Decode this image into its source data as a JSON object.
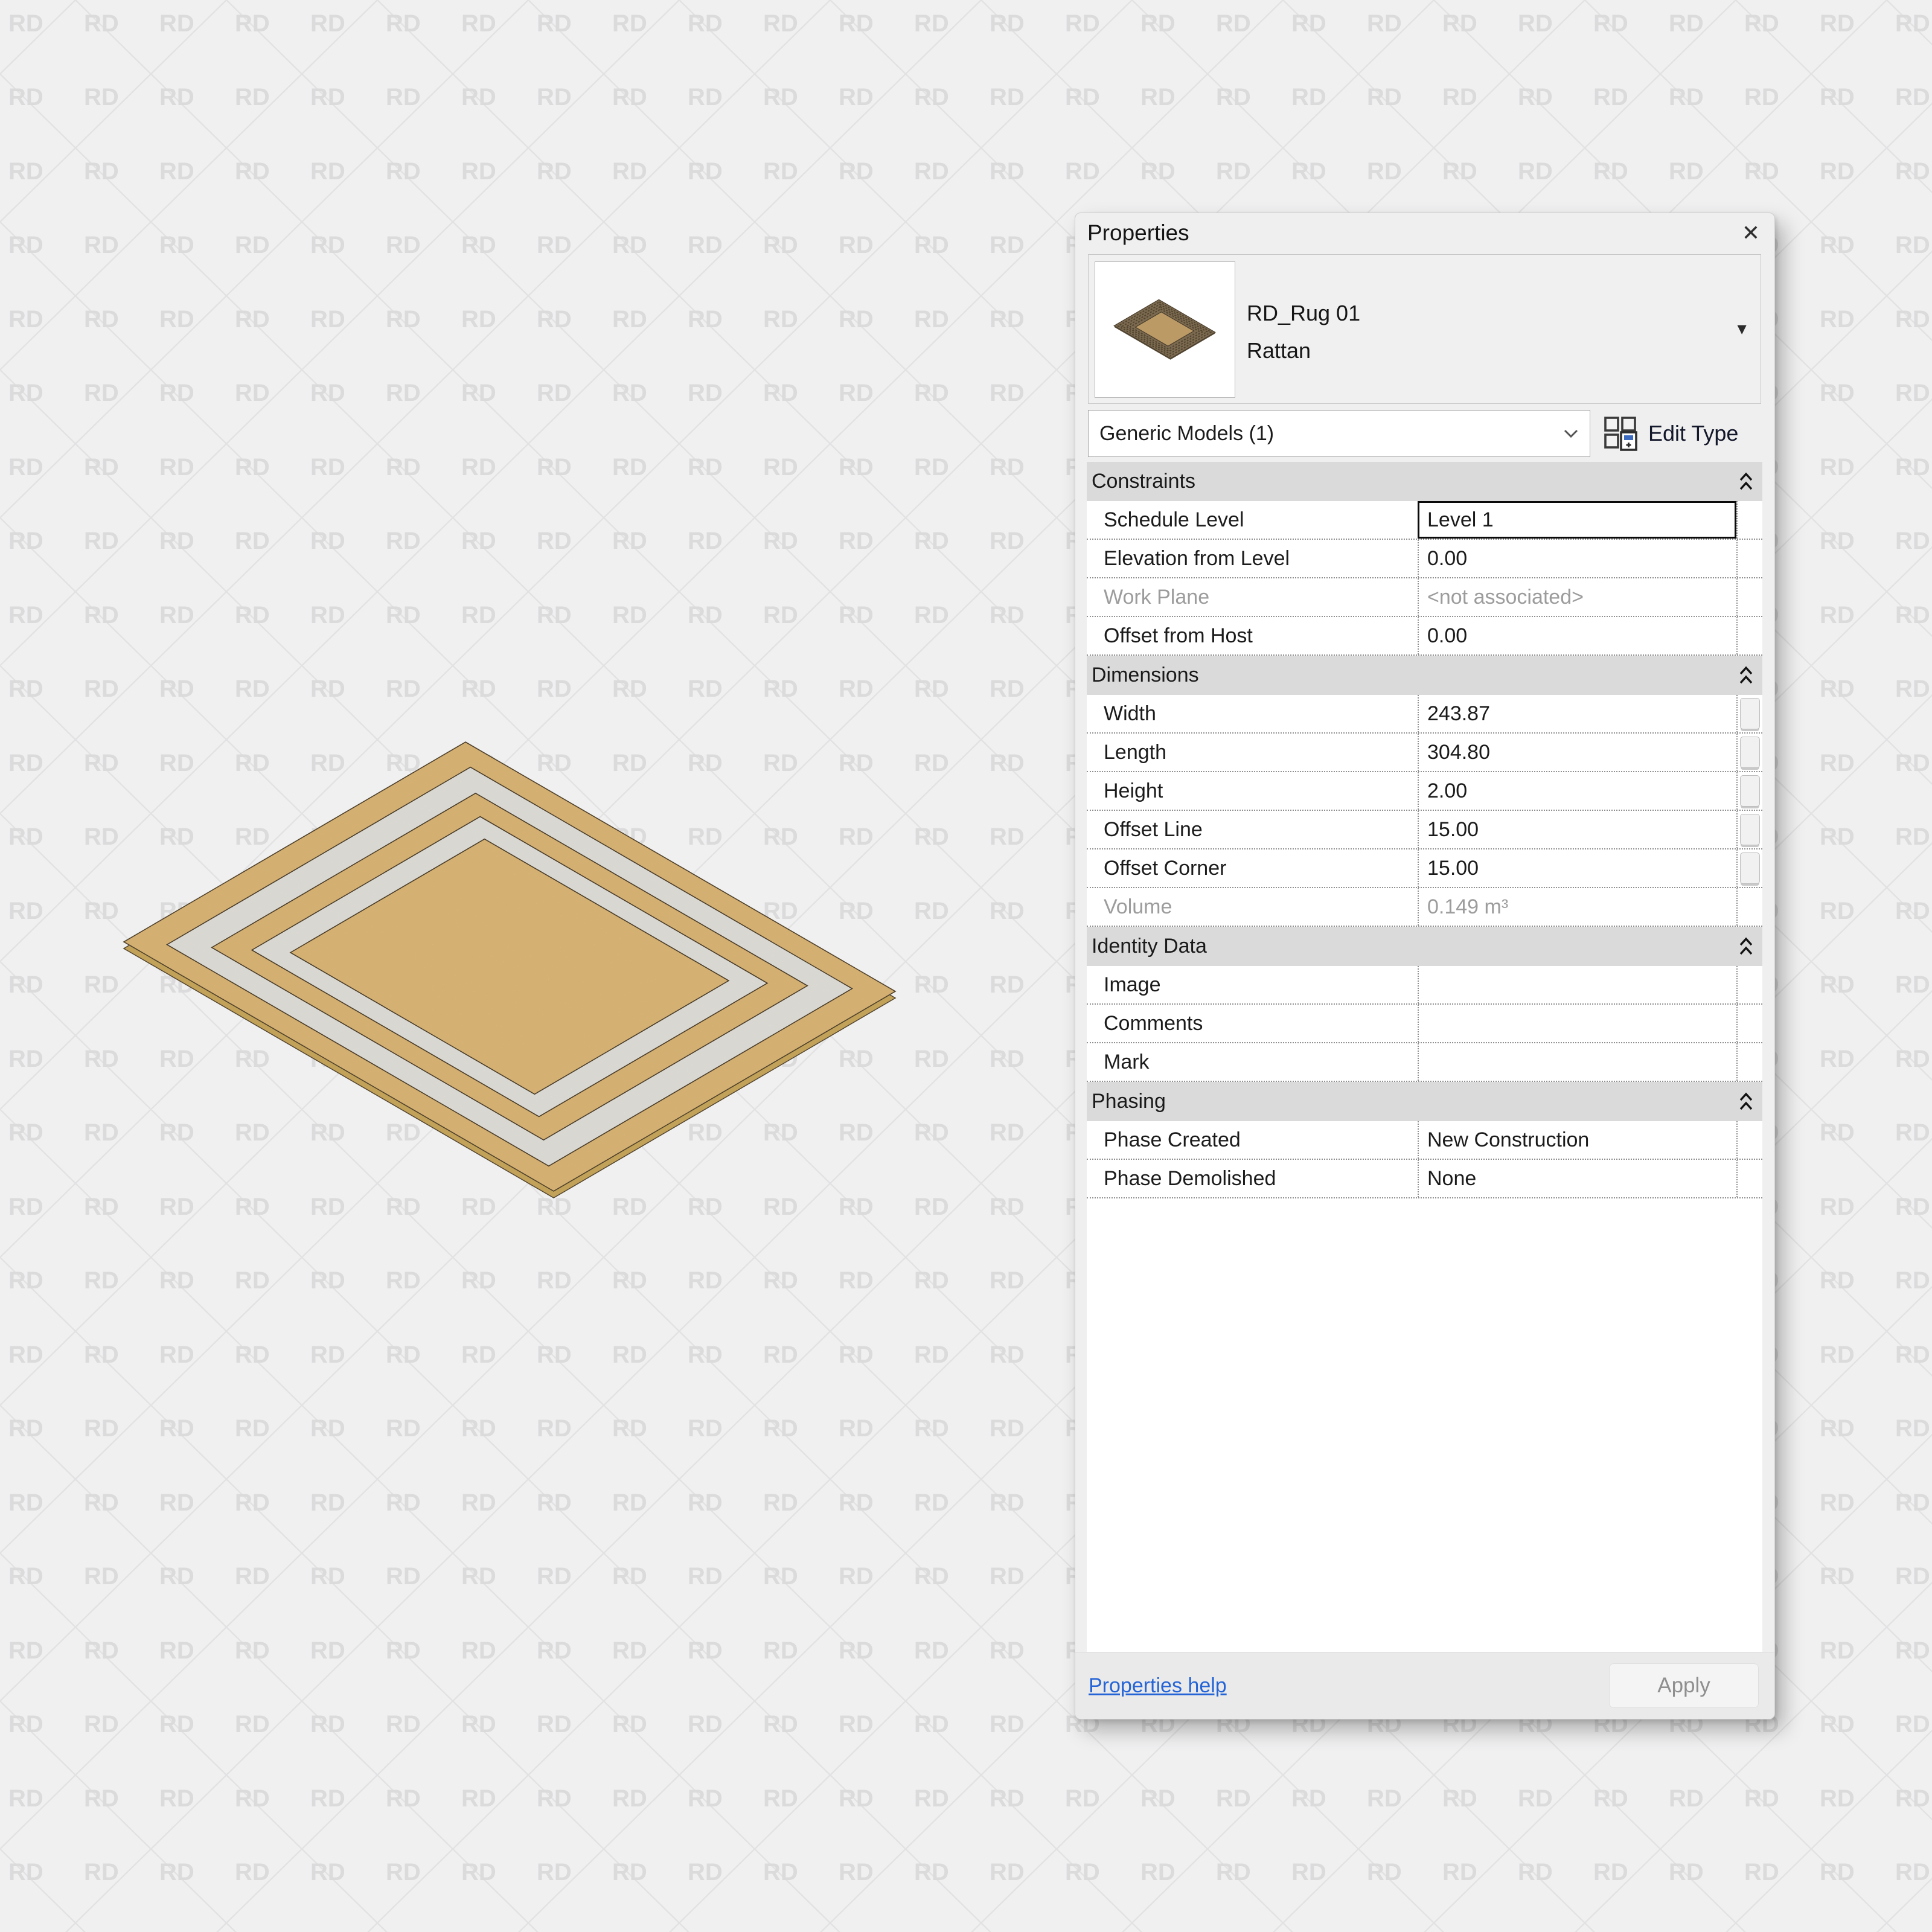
{
  "background": {
    "watermark_text": "RD"
  },
  "rug_colors": {
    "tan": "#ecc47f",
    "tan_center": "#edc680",
    "white_band": "#f2f1eb",
    "outline": "#54452f",
    "side": "#c2a258"
  },
  "panel": {
    "title": "Properties",
    "close_icon": "✕",
    "preview": {
      "family_name": "RD_Rug 01",
      "type_name": "Rattan",
      "dropdown_icon": "▼"
    },
    "type_selector": {
      "value": "Generic Models (1)"
    },
    "edit_type_label": "Edit Type",
    "sections": [
      {
        "title": "Constraints",
        "rows": [
          {
            "label": "Schedule Level",
            "value": "Level 1",
            "focused": true
          },
          {
            "label": "Elevation from Level",
            "value": "0.00"
          },
          {
            "label": "Work Plane",
            "value": "<not associated>",
            "disabled": true
          },
          {
            "label": "Offset from Host",
            "value": "0.00"
          }
        ]
      },
      {
        "title": "Dimensions",
        "rows": [
          {
            "label": "Width",
            "value": "243.87",
            "assoc_button": true
          },
          {
            "label": "Length",
            "value": "304.80",
            "assoc_button": true
          },
          {
            "label": "Height",
            "value": "2.00",
            "assoc_button": true
          },
          {
            "label": "Offset Line",
            "value": "15.00",
            "assoc_button": true
          },
          {
            "label": "Offset Corner",
            "value": "15.00",
            "assoc_button": true
          },
          {
            "label": "Volume",
            "value": "0.149 m³",
            "disabled": true
          }
        ]
      },
      {
        "title": "Identity Data",
        "rows": [
          {
            "label": "Image",
            "value": ""
          },
          {
            "label": "Comments",
            "value": ""
          },
          {
            "label": "Mark",
            "value": ""
          }
        ]
      },
      {
        "title": "Phasing",
        "rows": [
          {
            "label": "Phase Created",
            "value": "New Construction"
          },
          {
            "label": "Phase Demolished",
            "value": "None"
          }
        ]
      }
    ],
    "footer": {
      "help_label": "Properties help",
      "apply_label": "Apply"
    }
  }
}
